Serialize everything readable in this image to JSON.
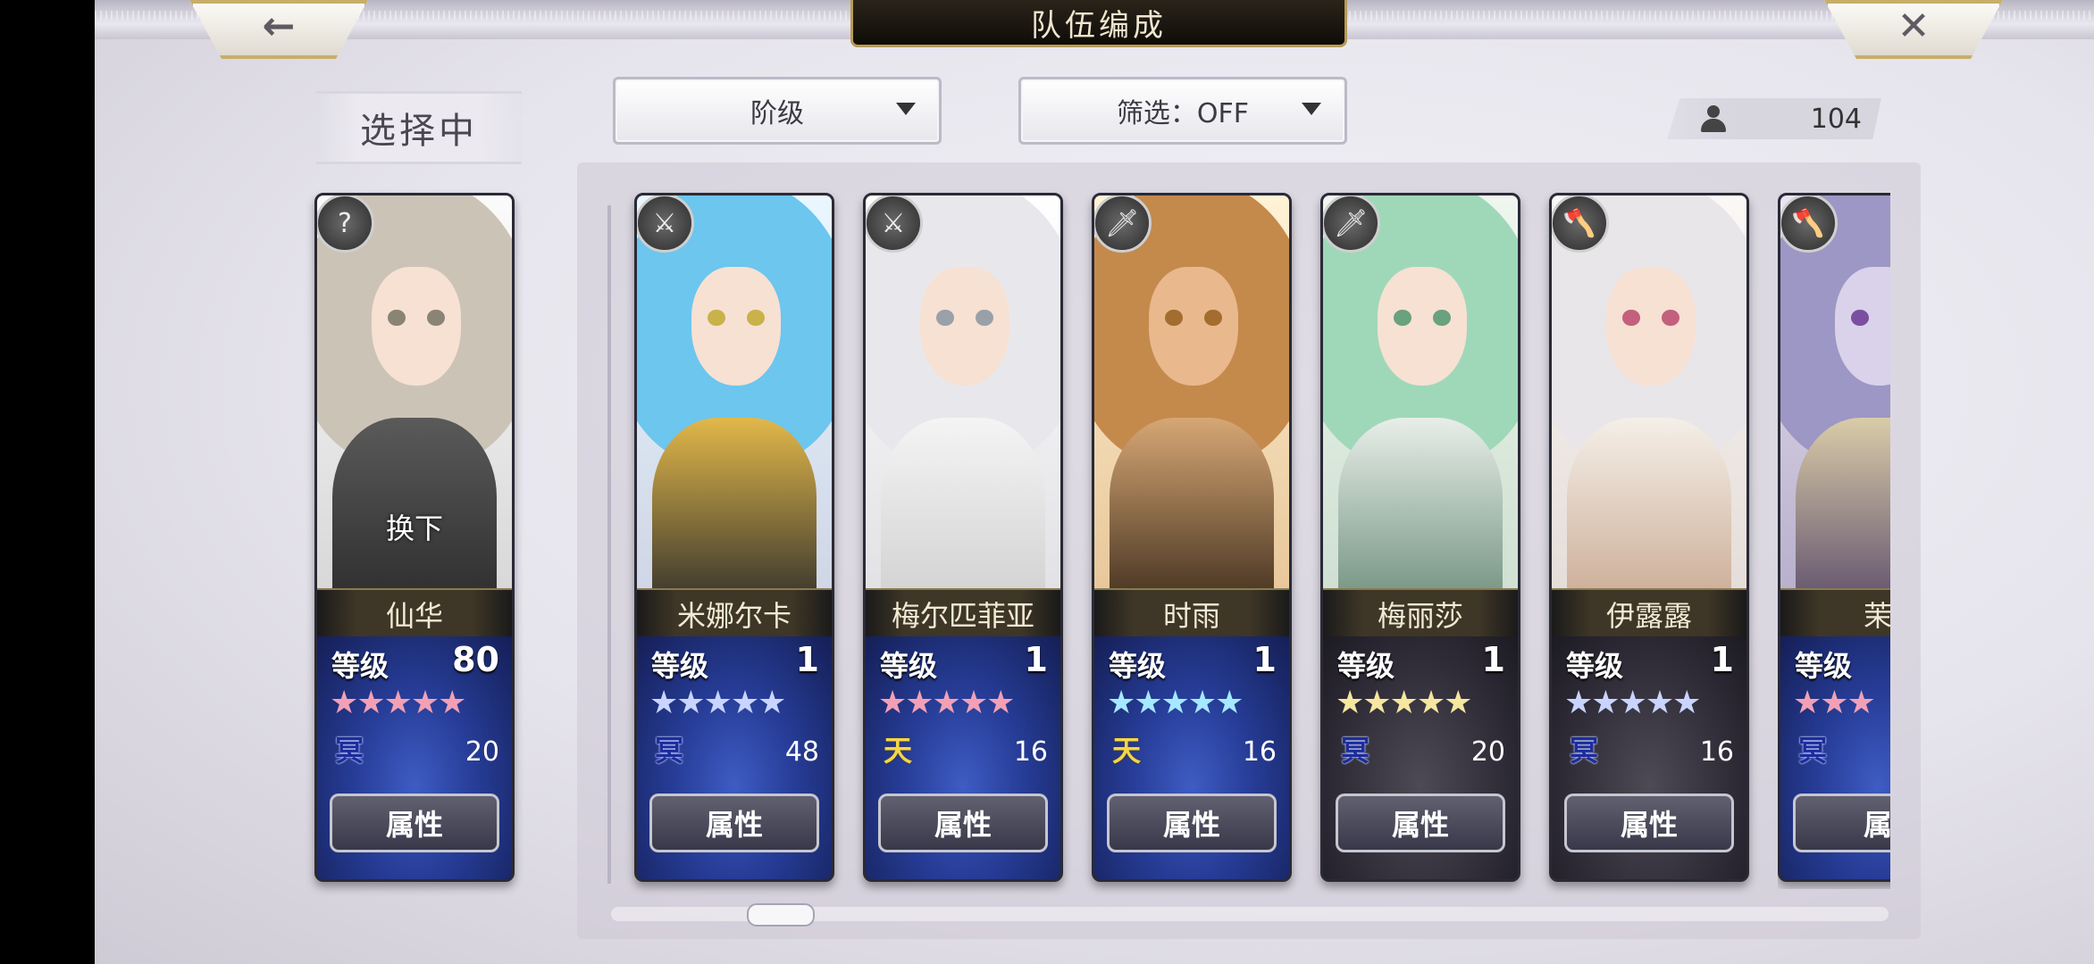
{
  "header": {
    "title": "队伍编成",
    "back_icon": "←",
    "close_icon": "✕"
  },
  "selecting": {
    "label": "选择中"
  },
  "dropdowns": {
    "rank": "阶级",
    "filter": "筛选：OFF"
  },
  "unit_count": "104",
  "current": {
    "name": "仙华",
    "level_label": "等级",
    "level": "80",
    "stars": "★★★★★",
    "affinity": "冥",
    "points": "20",
    "attr": "属性",
    "swap": "换下",
    "weapon_icon": "?"
  },
  "units": [
    {
      "name": "米娜尔卡",
      "level_label": "等级",
      "level": "1",
      "stars": "★★★★★",
      "affinity": "冥",
      "points": "48",
      "attr": "属性",
      "weapon_icon": "⚔"
    },
    {
      "name": "梅尔匹菲亚",
      "level_label": "等级",
      "level": "1",
      "stars": "★★★★★",
      "affinity": "天",
      "points": "16",
      "attr": "属性",
      "weapon_icon": "⚔"
    },
    {
      "name": "时雨",
      "level_label": "等级",
      "level": "1",
      "stars": "★★★★★",
      "affinity": "天",
      "points": "16",
      "attr": "属性",
      "weapon_icon": "🗡"
    },
    {
      "name": "梅丽莎",
      "level_label": "等级",
      "level": "1",
      "stars": "★★★★★",
      "affinity": "冥",
      "points": "20",
      "attr": "属性",
      "weapon_icon": "🗡"
    },
    {
      "name": "伊露露",
      "level_label": "等级",
      "level": "1",
      "stars": "★★★★★",
      "affinity": "冥",
      "points": "16",
      "attr": "属性",
      "weapon_icon": "🪓"
    },
    {
      "name": "茉",
      "level_label": "等级",
      "level": "",
      "stars": "★★★",
      "affinity": "冥",
      "points": "",
      "attr": "属",
      "weapon_icon": "🪓"
    }
  ],
  "colors": {
    "star_pink": "#f2a0b5",
    "star_blue": "#c9d4ff",
    "star_gold": "#f5e6a0",
    "panel": "#cdc8d6",
    "title_gold": "#b79a56"
  }
}
